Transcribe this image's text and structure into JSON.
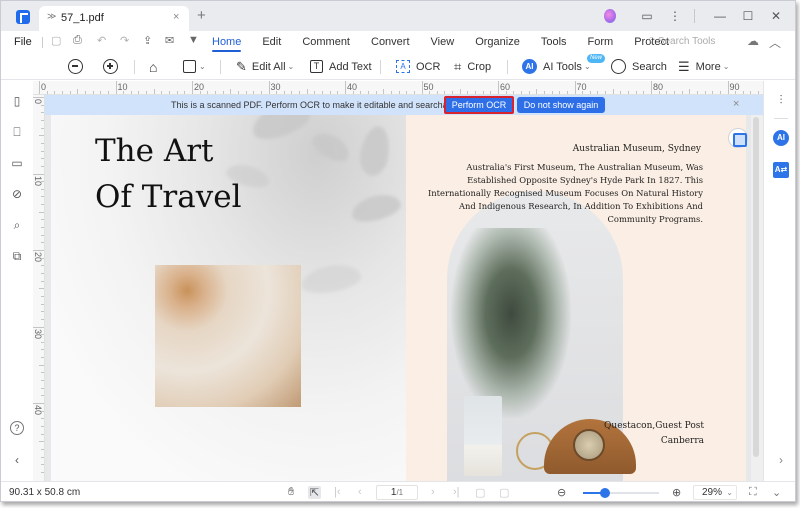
{
  "titlebar": {
    "tab_title": "57_1.pdf",
    "tab_chevron": "≫",
    "tab_close": "×",
    "new_tab": "+",
    "controls": {
      "feedback": "▭",
      "more": "⋮",
      "minimize": "—",
      "maximize": "☐",
      "close": "✕"
    }
  },
  "menubar": {
    "file": "File",
    "quick_access": [
      "save",
      "print",
      "undo",
      "redo",
      "share",
      "email",
      "customize"
    ],
    "items": [
      {
        "label": "Home",
        "active": true
      },
      {
        "label": "Edit"
      },
      {
        "label": "Comment"
      },
      {
        "label": "Convert"
      },
      {
        "label": "View"
      },
      {
        "label": "Organize"
      },
      {
        "label": "Tools"
      },
      {
        "label": "Form"
      },
      {
        "label": "Protect"
      }
    ],
    "search_tools_placeholder": "Search Tools"
  },
  "toolbar": {
    "edit_all": "Edit All",
    "add_text": "Add Text",
    "ocr": "OCR",
    "crop": "Crop",
    "ai_tools": "AI Tools",
    "ai_badge": "AI",
    "new_badge": "New",
    "search": "Search",
    "more": "More",
    "caret": "⌄"
  },
  "ocr_banner": {
    "message": "This is a scanned PDF. Perform OCR to make it editable and searchable.",
    "perform_ocr": "Perform OCR",
    "do_not_show": "Do not show again",
    "close": "×"
  },
  "rulers": {
    "top": [
      "0",
      "10",
      "20",
      "30",
      "40",
      "50",
      "60",
      "70",
      "80",
      "90"
    ],
    "left": [
      "0",
      "10",
      "20",
      "30",
      "40"
    ]
  },
  "document": {
    "title_line_1": "The Art",
    "title_line_2": "Of  Travel",
    "museum_title": "Australian Museum, Sydney",
    "museum_body": "Australia's First Museum, The Australian Museum, Was Established Opposite Sydney's Hyde Park In 1827. This Internationally Recognised Museum Focuses On Natural History And Indigenous Research, In Addition To Exhibitions And Community Programs.",
    "credit_line_1": "Questacon,Guest Post",
    "credit_line_2": "Canberra"
  },
  "right_sidebar": {
    "ai": "AI",
    "translate": "A⇄"
  },
  "statusbar": {
    "dimensions": "90.31 x 50.8 cm",
    "current_page": "1",
    "total_pages": "/1",
    "zoom_level": "29%",
    "zoom_fraction": 0.29,
    "zoom_caret": "⌄"
  },
  "colors": {
    "accent": "#2e6fe8",
    "banner_bg": "#d1e2fb",
    "highlight_border": "#d8232f",
    "page_right_bg": "#fbeee4"
  }
}
